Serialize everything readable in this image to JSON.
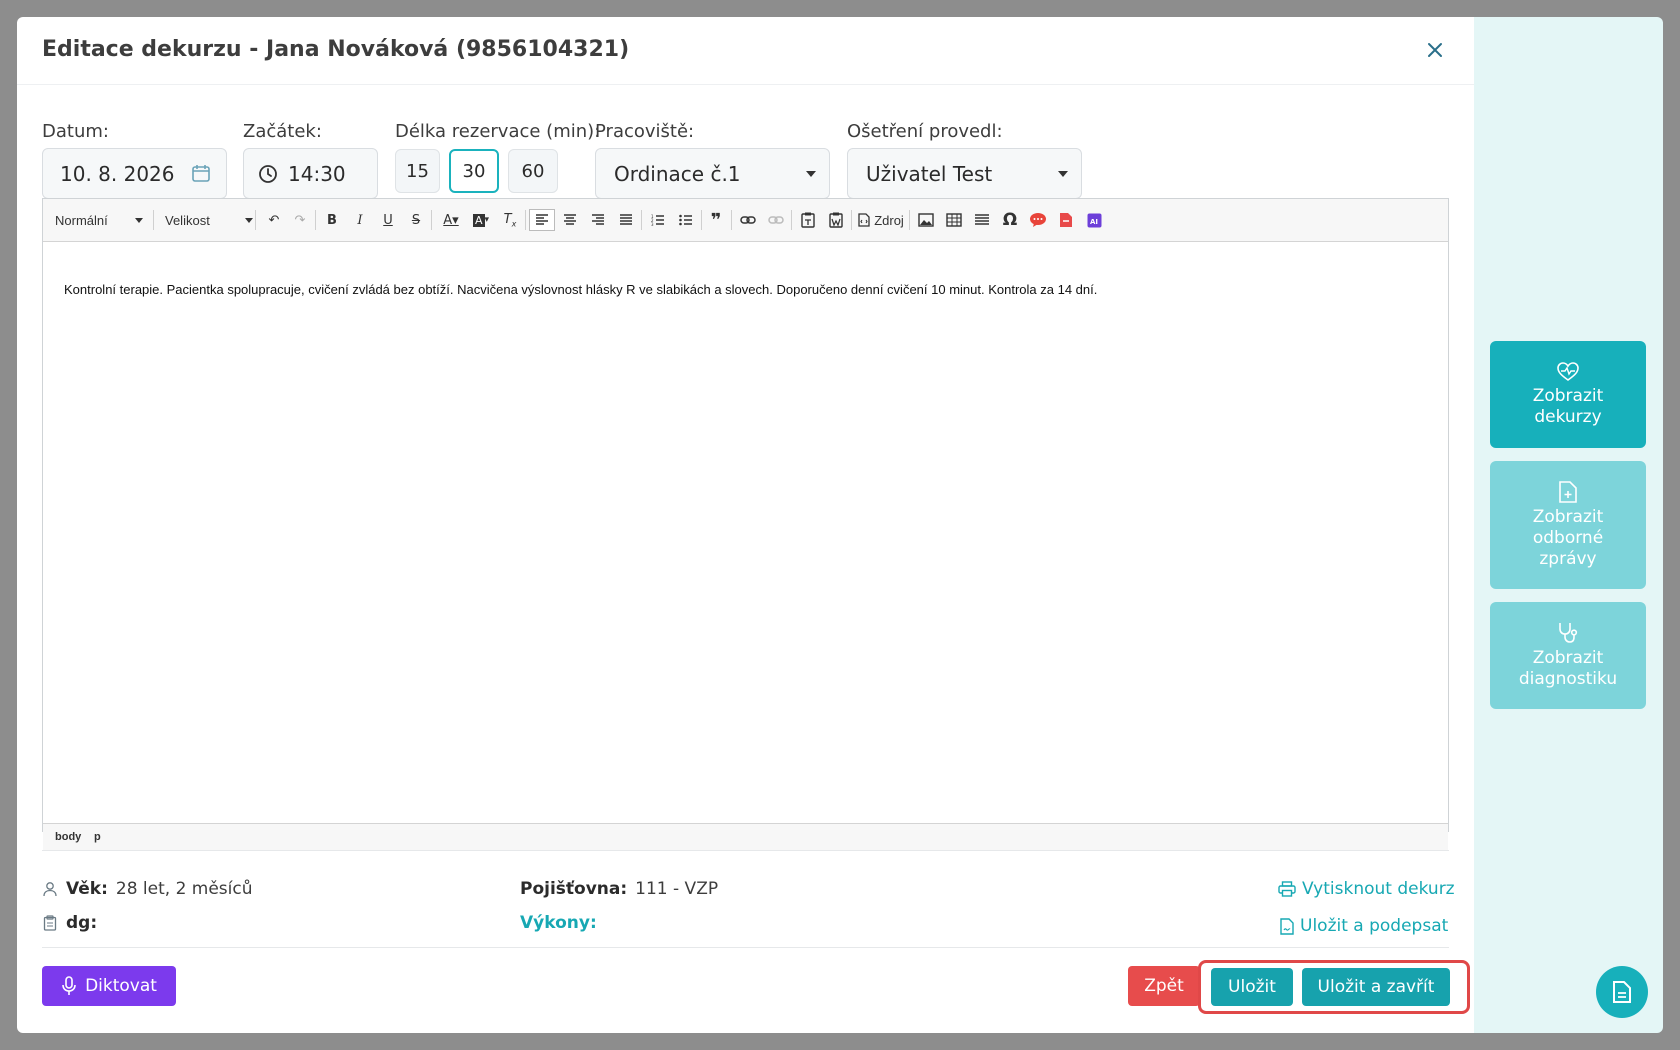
{
  "header": {
    "title": "Editace dekurzu - Jana Nováková (9856104321)"
  },
  "form": {
    "date_label": "Datum:",
    "date_value": "10. 8. 2026",
    "start_label": "Začátek:",
    "start_value": "14:30",
    "duration_label": "Délka rezervace (min):",
    "duration_options": [
      "15",
      "30",
      "60"
    ],
    "duration_selected": "30",
    "workplace_label": "Pracoviště:",
    "workplace_value": "Ordinace č.1",
    "performer_label": "Ošetření provedl:",
    "performer_value": "Uživatel Test"
  },
  "editor": {
    "format_select": "Normální",
    "size_select": "Velikost",
    "source_label": "Zdroj",
    "content": "Kontrolní terapie. Pacientka spolupracuje, cvičení zvládá bez obtíží. Nacvičena výslovnost hlásky R ve slabikách a slovech. Doporučeno denní cvičení 10 minut. Kontrola za 14 dní.",
    "path_body": "body",
    "path_p": "p"
  },
  "info": {
    "age_label": "Věk:",
    "age_value": "28 let, 2 měsíců",
    "dg_label": "dg:",
    "insurance_label": "Pojišťovna:",
    "insurance_value": "111 - VZP",
    "procedures_label": "Výkony:",
    "print_link": "Vytisknout dekurz",
    "save_sign_link": "Uložit a podepsat"
  },
  "actions": {
    "dictate": "Diktovat",
    "back": "Zpět",
    "save": "Uložit",
    "save_close": "Uložit a zavřít"
  },
  "side": {
    "show_records": "Zobrazit dekurzy",
    "show_reports": "Zobrazit odborné zprávy",
    "show_diagnostics": "Zobrazit diagnostiku"
  },
  "colors": {
    "accent": "#17b0bb",
    "purple": "#7c3aed",
    "danger": "#e74c4c"
  }
}
